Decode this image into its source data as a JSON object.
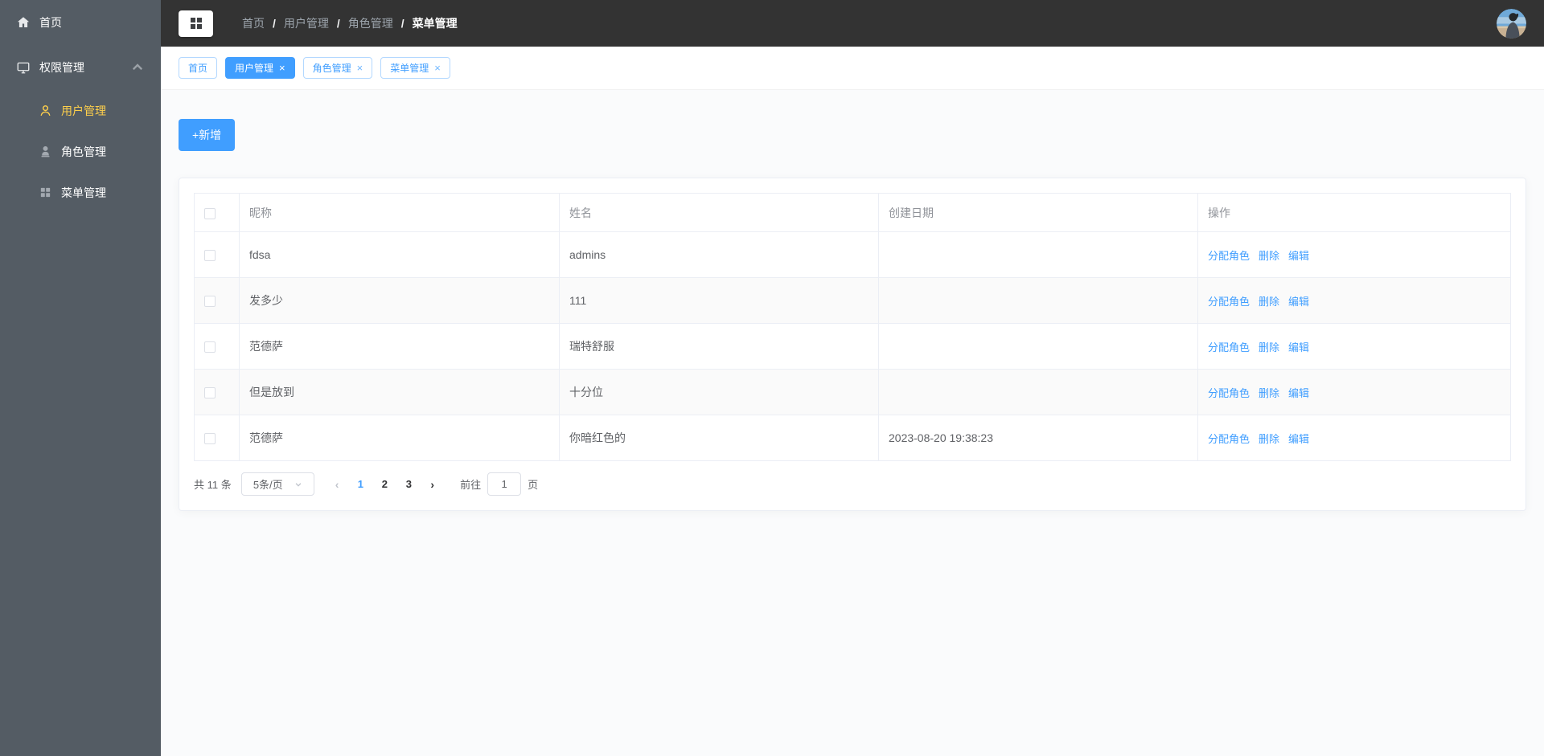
{
  "sidebar": {
    "home_label": "首页",
    "group_label": "权限管理",
    "items": [
      {
        "label": "用户管理"
      },
      {
        "label": "角色管理"
      },
      {
        "label": "菜单管理"
      }
    ]
  },
  "breadcrumb": {
    "separator": "/",
    "items": [
      "首页",
      "用户管理",
      "角色管理",
      "菜单管理"
    ]
  },
  "tabs": [
    {
      "label": "首页"
    },
    {
      "label": "用户管理"
    },
    {
      "label": "角色管理"
    },
    {
      "label": "菜单管理"
    }
  ],
  "tab_close_glyph": "×",
  "toolbar": {
    "add_label": "+新增"
  },
  "table": {
    "columns": {
      "nickname": "昵称",
      "name": "姓名",
      "created": "创建日期",
      "ops": "操作"
    },
    "actions": {
      "assign": "分配角色",
      "delete": "删除",
      "edit": "编辑"
    },
    "rows": [
      {
        "nickname": "fdsa",
        "name": "admins",
        "created": ""
      },
      {
        "nickname": "发多少",
        "name": "111",
        "created": ""
      },
      {
        "nickname": "范德萨",
        "name": "瑞特舒服",
        "created": ""
      },
      {
        "nickname": "但是放到",
        "name": "十分位",
        "created": ""
      },
      {
        "nickname": "范德萨",
        "name": "你暗红色的",
        "created": "2023-08-20 19:38:23"
      }
    ]
  },
  "pagination": {
    "total_label": "共 11 条",
    "page_size_label": "5条/页",
    "prev_glyph": "‹",
    "next_glyph": "›",
    "pages": [
      "1",
      "2",
      "3"
    ],
    "active_page": "1",
    "goto_label": "前往",
    "goto_value": "1",
    "goto_suffix": "页"
  },
  "colors": {
    "accent": "#409eff",
    "sidebar_bg": "#545c64",
    "header_bg": "#333333",
    "active_menu_text": "#ffd04b"
  }
}
